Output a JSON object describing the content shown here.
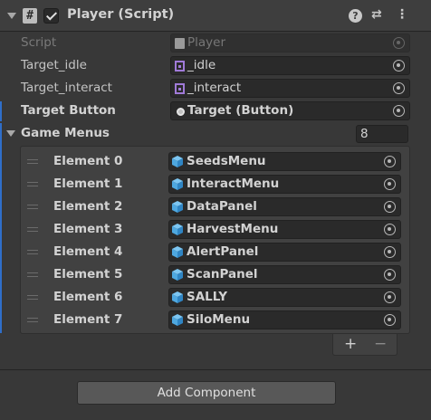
{
  "header": {
    "title": "Player (Script)",
    "script_icon": "#",
    "enabled": true,
    "help_icon": "?",
    "settings_icon": "⇄",
    "menu_icon": "⋮"
  },
  "fields": {
    "script": {
      "label": "Script",
      "value": "Player",
      "icon": "script-icon"
    },
    "target_idle": {
      "label": "Target_idle",
      "value": "_idle",
      "icon": "animation-clip-icon"
    },
    "target_interact": {
      "label": "Target_interact",
      "value": "_interact",
      "icon": "animation-clip-icon"
    },
    "target_button": {
      "label": "Target Button",
      "value": "Target (Button)",
      "icon": "button-icon"
    }
  },
  "game_menus": {
    "label": "Game Menus",
    "size": "8",
    "elements": [
      {
        "label": "Element 0",
        "value": "SeedsMenu"
      },
      {
        "label": "Element 1",
        "value": "InteractMenu"
      },
      {
        "label": "Element 2",
        "value": "DataPanel"
      },
      {
        "label": "Element 3",
        "value": "HarvestMenu"
      },
      {
        "label": "Element 4",
        "value": "AlertPanel"
      },
      {
        "label": "Element 5",
        "value": "ScanPanel"
      },
      {
        "label": "Element 6",
        "value": "SALLY"
      },
      {
        "label": "Element 7",
        "value": "SiloMenu"
      }
    ],
    "add_label": "+",
    "remove_label": "−"
  },
  "add_component_label": "Add Component",
  "colors": {
    "background": "#383838",
    "field": "#2a2a2a",
    "accent_bar": "#2f6ec9",
    "cube": "#4ea8e0",
    "anim_clip": "#a07ad8"
  }
}
